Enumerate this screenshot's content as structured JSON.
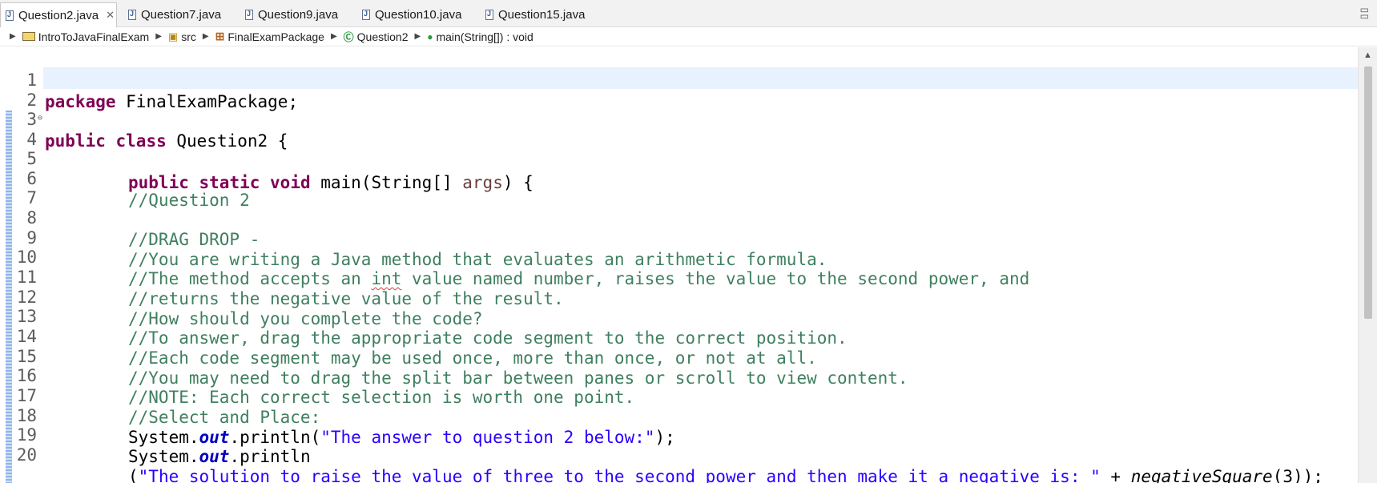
{
  "tabs": [
    {
      "label": "Question2.java",
      "active": true,
      "close": "✕"
    },
    {
      "label": "Question7.java",
      "active": false
    },
    {
      "label": "Question9.java",
      "active": false
    },
    {
      "label": "Question10.java",
      "active": false
    },
    {
      "label": "Question15.java",
      "active": false
    }
  ],
  "window_controls": {
    "minimize": "▭",
    "maximize": "▭"
  },
  "breadcrumb": {
    "project": "IntroToJavaFinalExam",
    "folder": "src",
    "package": "FinalExamPackage",
    "class": "Question2",
    "method": "main(String[]) : void"
  },
  "icons": {
    "java_file": "java-file-icon",
    "project": "project-folder-icon",
    "src": "source-folder-icon",
    "package": "package-icon",
    "class": "class-icon",
    "method": "method-icon",
    "close": "close-icon",
    "fold": "fold-collapse-icon",
    "scroll_up": "scroll-up-arrow-icon"
  },
  "colors": {
    "keyword": "#7f0055",
    "comment": "#3f7f5f",
    "string": "#2a00ff",
    "field": "#0000c0",
    "current_line": "#e8f2fe"
  },
  "editor": {
    "line_numbers": [
      "1",
      "2",
      "3",
      "4",
      "5",
      "6",
      "7",
      "8",
      "9",
      "10",
      "11",
      "12",
      "13",
      "14",
      "15",
      "16",
      "17",
      "18",
      "19",
      "20"
    ],
    "l1": {
      "kw": "package",
      "rest": " FinalExamPackage;"
    },
    "l3": {
      "kw1": "public",
      "kw2": "class",
      "rest": " Question2 {"
    },
    "l4": {
      "kw1": "public",
      "kw2": "static",
      "kw3": "void",
      "name": " main(String[] ",
      "param": "args",
      "rest": ") {"
    },
    "l6": "//Question 2",
    "l8": "//DRAG DROP -",
    "l9": "//You are writing a Java method that evaluates an arithmetic formula.",
    "l10": {
      "a": "//The method accepts an ",
      "int": "int",
      "b": " value named number, raises the value to the second power, and"
    },
    "l11": "//returns the negative value of the result.",
    "l12": "//How should you complete the code?",
    "l13": "//To answer, drag the appropriate code segment to the correct position.",
    "l14": "//Each code segment may be used once, more than once, or not at all.",
    "l15": "//You may need to drag the split bar between panes or scroll to view content.",
    "l16": "//NOTE: Each correct selection is worth one point.",
    "l17": "//Select and Place:",
    "l18": {
      "sys": "System.",
      "out": "out",
      "call": ".println(",
      "str": "\"The answer to question 2 below:\"",
      "end": ");"
    },
    "l19": {
      "sys": "System.",
      "out": "out",
      "call": ".println"
    },
    "l20": {
      "open": "(",
      "str": "\"The solution to raise the value of three to the second power and then make it a negative is: \"",
      "plus": " + ",
      "fn": "negativeSquare",
      "end": "(3));"
    }
  }
}
